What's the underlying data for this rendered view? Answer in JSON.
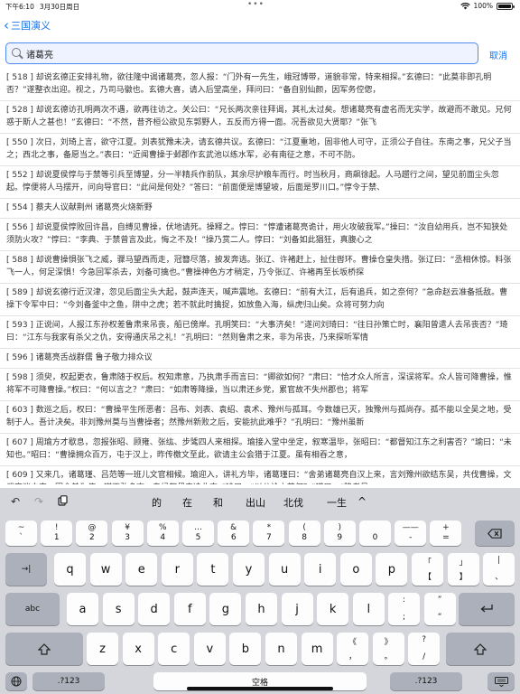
{
  "status": {
    "time": "下午6:10",
    "date": "3月30日周日",
    "battery": "100%",
    "battery_level": 1.0
  },
  "nav": {
    "back_label": "三国演义"
  },
  "search": {
    "query": "诸葛亮",
    "cancel_label": "取消"
  },
  "results": [
    "[ 518 ] 却说玄德正安排礼物，欲往隆中谒诸葛亮，忽人报：“门外有一先生，峨冠博带，道貌非常，特来相探。”玄德曰：“此莫非即孔明否？”遂整衣出迎。视之，乃司马徽也。玄德大喜，请入后堂高坐，拜问曰：“备自别仙颜，因军务倥偬，",
    "[ 528 ] 却说玄德访孔明两次不遇，欲再往访之。关公曰：“兄长两次亲往拜谒，其礼太过矣。想诸葛亮有虚名而无实学，故避而不敢见。兄何惑于斯人之甚也！”玄德曰：“不然，昔齐桓公欲见东郭野人，五反而方得一面。况吾欲见大贤耶？”张飞",
    "[ 550 ] 次日，刘琦上言，欲守江夏。刘表犹豫未决，请玄德共议。玄德曰：“江夏重地，固非他人可守，正须公子自往。东南之事，兄父子当之；西北之事，备愿当之。”表曰：“近闻曹操于邺郡作玄武池以练水军，必有南征之意，不可不防。",
    "[ 552 ] 却说夏侯惇与于禁等引兵至博望，分一半精兵作前队，其余尽护粮车而行。时当秋月，商飙徐起。人马趱行之间，望见前面尘头忽起。惇便将人马摆开，问向导官曰：“此间是何处？”答曰：“前面便是博望坡，后面是罗川口。”惇令于禁、",
    "[ 554 ] 蔡夫人议献荆州 诸葛亮火烧新野",
    "[ 556 ] 却说夏侯惇败回许昌，自缚见曹操，伏地请死。操释之。惇曰：“惇遭诸葛亮诡计，用火攻破我军。”操曰：“汝自幼用兵，岂不知狭处须防火攻？”惇曰：“李典、于禁曾言及此，悔之不及！”操乃赏二人。惇曰：“刘备如此猖狂，真腹心之",
    "[ 588 ] 却说曹操惧张飞之威，骤马望西而走，冠簪尽落，披发奔逃。张辽、许褚赶上，扯住辔环。曹操仓皇失措。张辽曰：“丞相休惊。料张飞一人，何足深惧！今急回军杀去，刘备可擒也。”曹操神色方才稍定，乃令张辽、许褚再至长坂桥探",
    "[ 589 ] 却说玄德行近汉津，忽见后面尘头大起，鼓声连天，喊声震地。玄德曰：“前有大江，后有追兵，如之奈何？”急命赵云准备抵敌。曹操下令军中曰：“今刘备釜中之鱼，阱中之虎；若不就此时擒捉，如放鱼入海，纵虎归山矣。众将可努力向",
    "[ 593 ] 正说间，人报江东孙权差鲁肃来吊丧，船已傍岸。孔明笑曰：“大事济矣！”遂问刘琦曰：“往日孙策亡时，襄阳曾遣人去吊丧否？”琦曰：“江东与我家有杀父之仇，安得通庆吊之礼！”孔明曰：“然则鲁肃之来，非为吊丧，乃来探听军情",
    "[ 596 ] 诸葛亮舌战群儒 鲁子敬力排众议",
    "[ 598 ] 须臾，权起更衣，鲁肃随于权后。权知肃意，乃执肃手而言曰：“卿欲如何？”肃曰：“恰才众人所言，深误将军。众人皆可降曹操，惟将军不可降曹操。”权曰：“何以言之？”肃曰：“如肃等降操，当以肃还乡党，累官故不失州郡也；将军",
    "[ 603 ] 数巡之后，权曰：“曹操平生所恶者：吕布、刘表、袁绍、袁术、豫州与孤耳。今数雄已灭，独豫州与孤尚存。孤不能以全吴之地，受制于人。吾计决矣。非刘豫州莫与当曹操者；然豫州新败之后，安能抗此难乎？”孔明曰：“豫州虽新",
    "[ 607 ] 周瑜方才歇息，忽报张昭、顾雍、张纮、步骘四人来相探。瑜接入堂中坐定，叙寒温毕，张昭曰：“都督知江东之利害否？”瑜曰：“未知也。”昭曰：“曹操拥众百万，屯于汉上，昨传檄文至此，欲请主公会猎于江夏。虽有相吞之意，",
    "[ 609 ] 又来几，诸葛瑾、吕范等一班儿文官相候。瑜迎入，讲礼方毕，诸葛瑾曰：“舍弟诸葛亮自汉上来，言刘豫州欲结东吴，共伐曹操，文武商议未定。因舍弟为使，瑾不敢多言，专候都督来决此事。”瑜曰：“以公论之若何？”瑾曰：“降者易"
  ],
  "keyboard": {
    "suggestions": [
      "的",
      "在",
      "和",
      "出山",
      "北伐",
      "一生"
    ],
    "row_num": [
      {
        "sub": "~",
        "main": "`"
      },
      {
        "sub": "!",
        "main": "1"
      },
      {
        "sub": "@",
        "main": "2"
      },
      {
        "sub": "¥",
        "main": "3"
      },
      {
        "sub": "%",
        "main": "4"
      },
      {
        "sub": "…",
        "main": "5"
      },
      {
        "sub": "&",
        "main": "6"
      },
      {
        "sub": "*",
        "main": "7"
      },
      {
        "sub": "(",
        "main": "8"
      },
      {
        "sub": ")",
        "main": "9"
      },
      {
        "sub": "",
        "main": "0"
      },
      {
        "sub": "——",
        "main": "-"
      },
      {
        "sub": "+",
        "main": "="
      }
    ],
    "row_q": [
      "q",
      "w",
      "e",
      "r",
      "t",
      "y",
      "u",
      "i",
      "o",
      "p"
    ],
    "row_q_extra": [
      {
        "sub": "「",
        "main": "【"
      },
      {
        "sub": "」",
        "main": "】"
      },
      {
        "sub": "|",
        "main": "、"
      }
    ],
    "row_a": [
      "a",
      "s",
      "d",
      "f",
      "g",
      "h",
      "j",
      "k",
      "l"
    ],
    "row_a_extra": [
      {
        "sub": ":",
        "main": ";"
      },
      {
        "sub": "”",
        "main": "“"
      }
    ],
    "row_z": [
      "z",
      "x",
      "c",
      "v",
      "b",
      "n",
      "m"
    ],
    "row_z_extra": [
      {
        "sub": "《",
        "main": "，"
      },
      {
        "sub": "》",
        "main": "。"
      },
      {
        "sub": "?",
        "main": "/"
      }
    ],
    "tab_label": "→|",
    "abc_label": "abc",
    "mode_label": ".?123",
    "space_label": "空格"
  }
}
